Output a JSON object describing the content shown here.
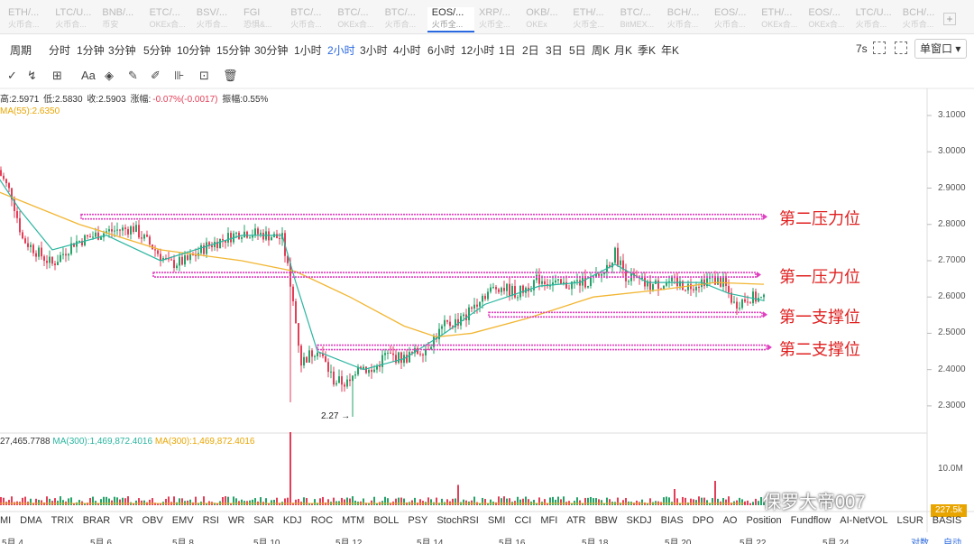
{
  "tabs": [
    {
      "name": "ETH/...",
      "sub": "火币合..."
    },
    {
      "name": "LTC/U...",
      "sub": "火币合..."
    },
    {
      "name": "BNB/...",
      "sub": "币安"
    },
    {
      "name": "ETC/...",
      "sub": "OKEx合..."
    },
    {
      "name": "BSV/...",
      "sub": "火币合..."
    },
    {
      "name": "FGI",
      "sub": "恐惧&..."
    },
    {
      "name": "BTC/...",
      "sub": "火币合..."
    },
    {
      "name": "BTC/...",
      "sub": "OKEx合..."
    },
    {
      "name": "BTC/...",
      "sub": "火币合..."
    },
    {
      "name": "EOS/...",
      "sub": "火币全..."
    },
    {
      "name": "XRP/...",
      "sub": "火币全..."
    },
    {
      "name": "OKB/...",
      "sub": "OKEx"
    },
    {
      "name": "ETH/...",
      "sub": "火币全..."
    },
    {
      "name": "BTC/...",
      "sub": "BitMEX..."
    },
    {
      "name": "BCH/...",
      "sub": "火币合..."
    },
    {
      "name": "EOS/...",
      "sub": "火币合..."
    },
    {
      "name": "ETH/...",
      "sub": "OKEx合..."
    },
    {
      "name": "EOS/...",
      "sub": "OKEx合..."
    },
    {
      "name": "LTC/U...",
      "sub": "火币合..."
    },
    {
      "name": "BCH/...",
      "sub": "火币合..."
    }
  ],
  "active_tab": 9,
  "tab_add": "+",
  "toolbar": {
    "period_label": "周期",
    "periods": [
      "分时",
      "1分钟",
      "3分钟",
      "5分钟",
      "10分钟",
      "15分钟",
      "30分钟",
      "1小时",
      "2小时",
      "3小时",
      "4小时",
      "6小时",
      "12小时",
      "1日",
      "2日",
      "3日",
      "5日",
      "周K",
      "月K",
      "季K",
      "年K"
    ],
    "active_period": "2小时",
    "interval": "7s",
    "window_label": "单窗口"
  },
  "tools": [
    "✓",
    "↯",
    "⊞",
    "Aa",
    "◈",
    "✎",
    "✐",
    "⊪",
    "⊡",
    "🗑"
  ],
  "info": {
    "high": "高:2.5971",
    "low": "低:2.5830",
    "close": "收:2.5903",
    "change_label": "涨幅:",
    "change": "-0.07%(-0.0017)",
    "amp": "振幅:0.55%",
    "ma55": "MA(55):2.6350"
  },
  "volume_info": {
    "vol": "27,465.7788",
    "ma1": "MA(300):1,469,872.4016",
    "ma2": "MA(300):1,469,872.4016"
  },
  "annotations": [
    {
      "text": "第二压力位",
      "price": 2.82
    },
    {
      "text": "第一压力位",
      "price": 2.66
    },
    {
      "text": "第一支撑位",
      "price": 2.55
    },
    {
      "text": "第二支撑位",
      "price": 2.46
    }
  ],
  "low_marker": "2.27 →",
  "y_ticks": [
    "3.1000",
    "3.0000",
    "2.9000",
    "2.8000",
    "2.7000",
    "2.6000",
    "2.5000",
    "2.4000",
    "2.3000"
  ],
  "vol_tick": "10.0M",
  "vol_tag": "227.5k",
  "x_labels": [
    "5月 4",
    "5月 6",
    "5月 8",
    "5月 10",
    "5月 12",
    "5月 14",
    "5月 16",
    "5月 18",
    "5月 20",
    "5月 22",
    "5月 24"
  ],
  "x_extra": [
    "对数",
    "自动"
  ],
  "indicators": [
    "DMI",
    "DMA",
    "TRIX",
    "BRAR",
    "VR",
    "OBV",
    "EMV",
    "RSI",
    "WR",
    "SAR",
    "KDJ",
    "ROC",
    "MTM",
    "BOLL",
    "PSY",
    "StochRSI",
    "SMI",
    "CCI",
    "MFI",
    "ATR",
    "BBW",
    "SKDJ",
    "BIAS",
    "DPO",
    "AO",
    "Position",
    "Fundflow",
    "AI-NetVOL",
    "LSUR",
    "BASIS"
  ],
  "watermark": "保罗大帝007",
  "colors": {
    "up": "#26a269",
    "down": "#e23e57",
    "band": "#e040c0",
    "label": "#e02020",
    "ma_slow": "#f2b632",
    "ma_fast": "#2bb5a0",
    "accent": "#2a68e0"
  },
  "chart_data": {
    "type": "candlestick",
    "y_range": [
      2.25,
      3.12
    ],
    "anchors": [
      [
        0,
        2.95
      ],
      [
        5,
        2.88
      ],
      [
        9,
        2.76
      ],
      [
        15,
        2.72
      ],
      [
        20,
        2.69
      ],
      [
        28,
        2.75
      ],
      [
        40,
        2.78
      ],
      [
        50,
        2.79
      ],
      [
        58,
        2.73
      ],
      [
        63,
        2.69
      ],
      [
        70,
        2.7
      ],
      [
        77,
        2.74
      ],
      [
        90,
        2.78
      ],
      [
        100,
        2.77
      ],
      [
        105,
        2.76
      ],
      [
        108,
        2.64
      ],
      [
        112,
        2.42
      ],
      [
        118,
        2.46
      ],
      [
        124,
        2.37
      ],
      [
        130,
        2.36
      ],
      [
        133,
        2.42
      ],
      [
        138,
        2.39
      ],
      [
        143,
        2.44
      ],
      [
        150,
        2.43
      ],
      [
        158,
        2.46
      ],
      [
        165,
        2.52
      ],
      [
        172,
        2.54
      ],
      [
        178,
        2.6
      ],
      [
        185,
        2.63
      ],
      [
        192,
        2.61
      ],
      [
        200,
        2.65
      ],
      [
        208,
        2.63
      ],
      [
        215,
        2.64
      ],
      [
        222,
        2.65
      ],
      [
        228,
        2.72
      ],
      [
        232,
        2.66
      ],
      [
        240,
        2.63
      ],
      [
        248,
        2.64
      ],
      [
        255,
        2.63
      ],
      [
        262,
        2.65
      ],
      [
        268,
        2.64
      ],
      [
        272,
        2.58
      ],
      [
        278,
        2.6
      ],
      [
        283,
        2.59
      ]
    ],
    "ma55_points": [
      [
        0,
        2.89
      ],
      [
        10,
        2.86
      ],
      [
        30,
        2.8
      ],
      [
        60,
        2.73
      ],
      [
        90,
        2.7
      ],
      [
        110,
        2.67
      ],
      [
        130,
        2.6
      ],
      [
        150,
        2.52
      ],
      [
        162,
        2.49
      ],
      [
        175,
        2.5
      ],
      [
        195,
        2.54
      ],
      [
        220,
        2.6
      ],
      [
        245,
        2.62
      ],
      [
        265,
        2.64
      ],
      [
        283,
        2.635
      ]
    ],
    "fast_ma_points": [
      [
        0,
        2.93
      ],
      [
        8,
        2.84
      ],
      [
        20,
        2.73
      ],
      [
        40,
        2.77
      ],
      [
        60,
        2.7
      ],
      [
        90,
        2.77
      ],
      [
        105,
        2.77
      ],
      [
        110,
        2.64
      ],
      [
        118,
        2.45
      ],
      [
        135,
        2.4
      ],
      [
        150,
        2.43
      ],
      [
        165,
        2.5
      ],
      [
        180,
        2.58
      ],
      [
        200,
        2.63
      ],
      [
        215,
        2.64
      ],
      [
        228,
        2.69
      ],
      [
        240,
        2.64
      ],
      [
        260,
        2.64
      ],
      [
        270,
        2.61
      ],
      [
        283,
        2.59
      ]
    ],
    "volume_spikes": [
      [
        108,
        9
      ],
      [
        170,
        2.5
      ],
      [
        250,
        2
      ],
      [
        265,
        3
      ]
    ]
  }
}
